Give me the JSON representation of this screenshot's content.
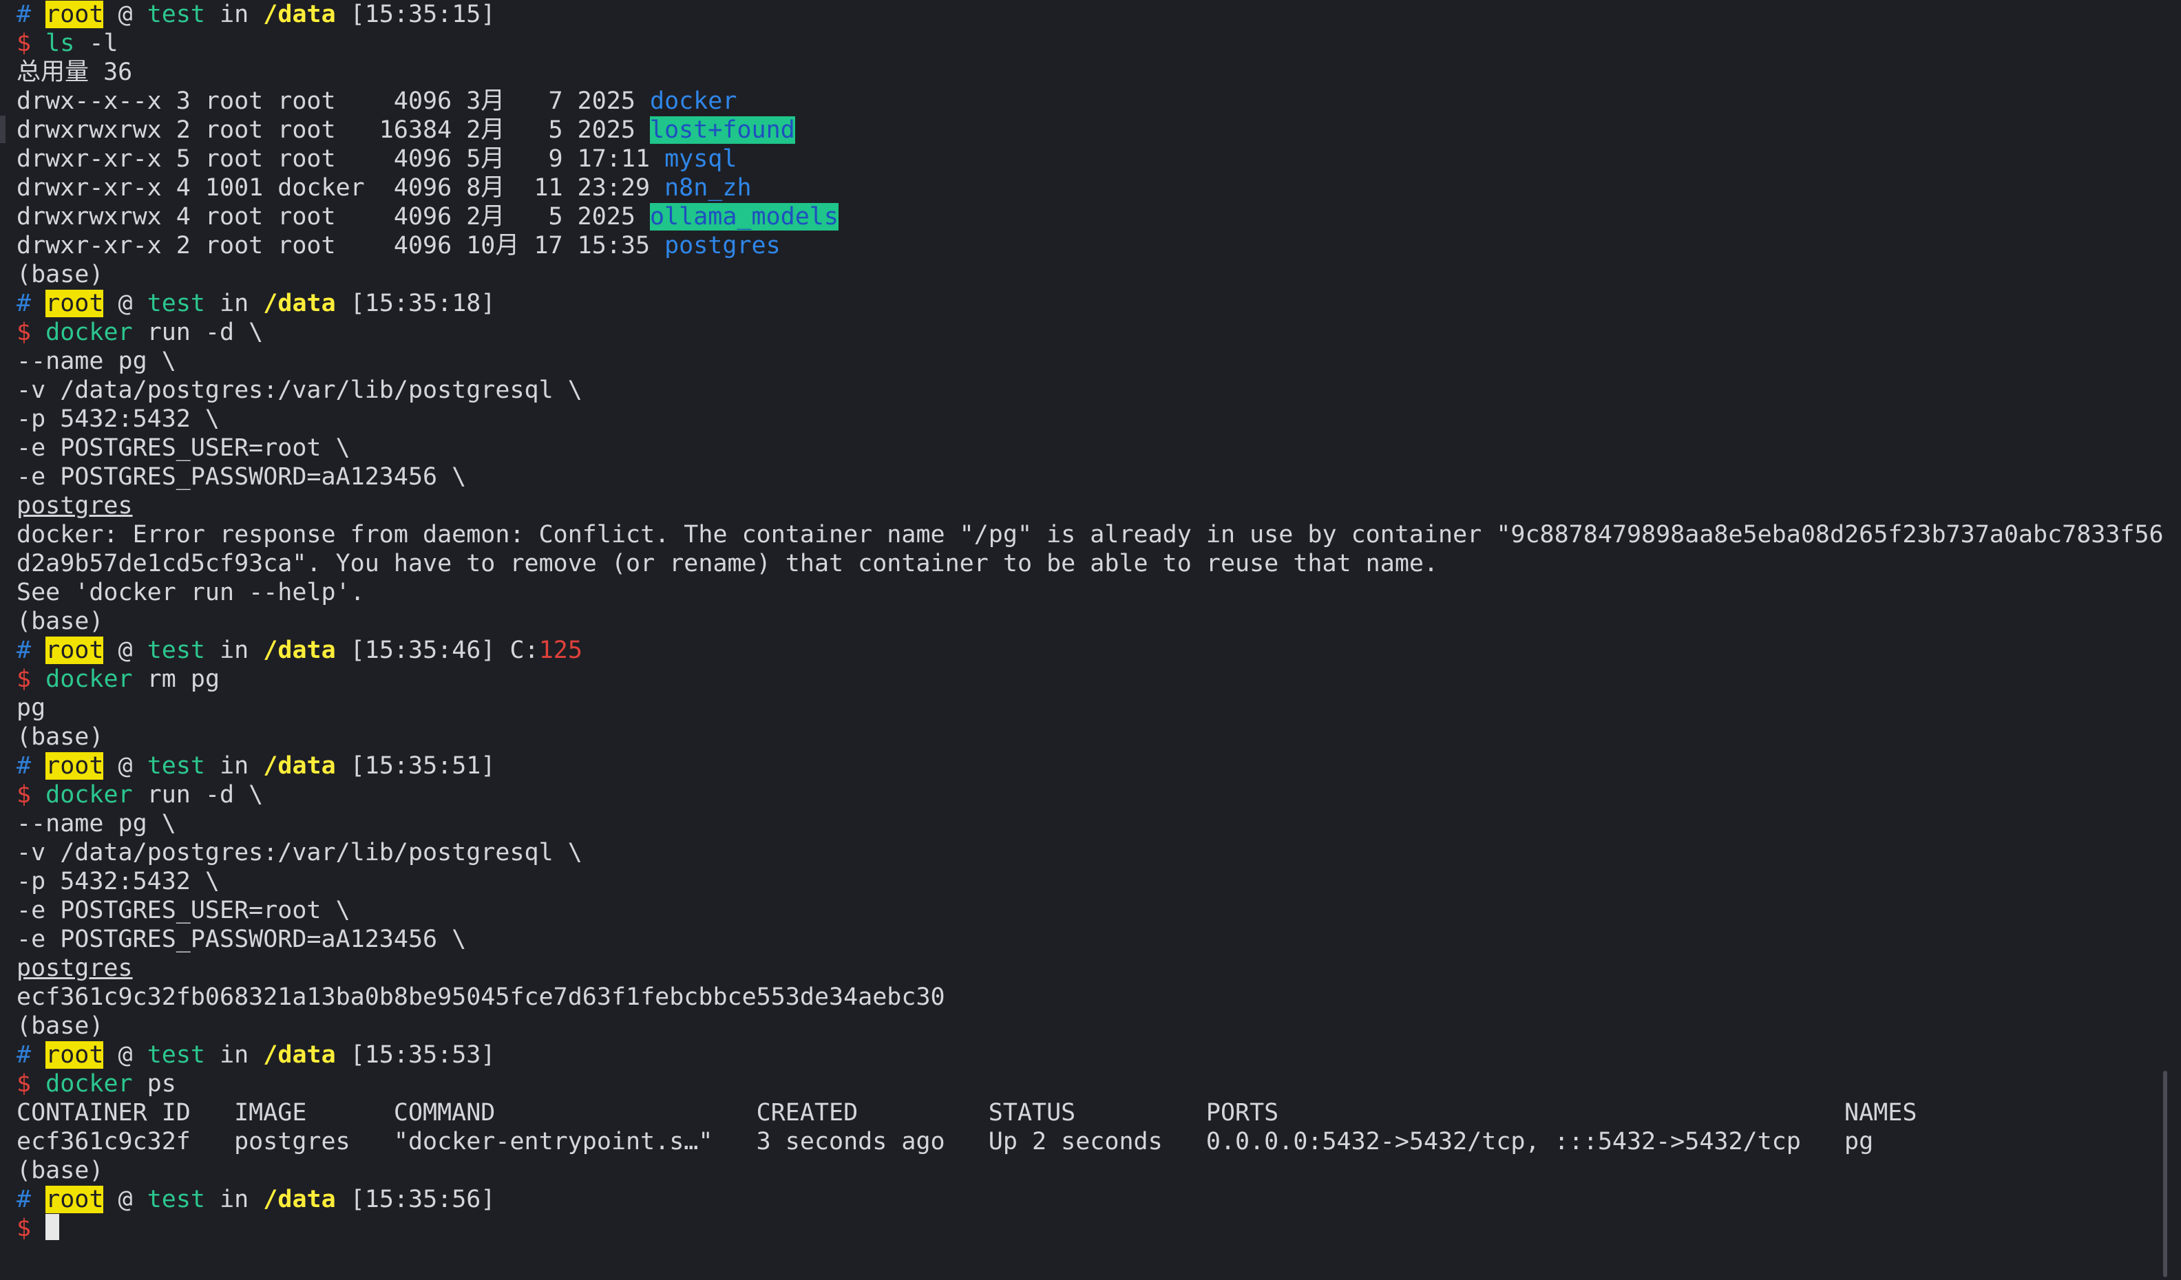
{
  "prompt": {
    "hash": "#",
    "user": "root",
    "at": "@",
    "host": "test",
    "in": "in",
    "path": "/data",
    "dollar": "$",
    "code_label": "C:"
  },
  "blocks": [
    {
      "time": "[15:35:15]",
      "cmd": "ls",
      "args": " -l",
      "output": {
        "total": "总用量 36",
        "ls_rows": [
          {
            "meta": "drwx--x--x 3 root root    4096 3月   7 2025 ",
            "name": "docker",
            "highlight": false
          },
          {
            "meta": "drwxrwxrwx 2 root root   16384 2月   5 2025 ",
            "name": "lost+found",
            "highlight": true
          },
          {
            "meta": "drwxr-xr-x 5 root root    4096 5月   9 17:11 ",
            "name": "mysql",
            "highlight": false
          },
          {
            "meta": "drwxr-xr-x 4 1001 docker  4096 8月  11 23:29 ",
            "name": "n8n_zh",
            "highlight": false
          },
          {
            "meta": "drwxrwxrwx 4 root root    4096 2月   5 2025 ",
            "name": "ollama_models",
            "highlight": true
          },
          {
            "meta": "drwxr-xr-x 2 root root    4096 10月 17 15:35 ",
            "name": "postgres",
            "highlight": false
          }
        ]
      },
      "base": "(base)"
    },
    {
      "time": "[15:35:18]",
      "cmd": "docker",
      "args": " run -d \\",
      "continuation": [
        "--name pg \\",
        "-v /data/postgres:/var/lib/postgresql \\",
        "-p 5432:5432 \\",
        "-e POSTGRES_USER=root \\",
        "-e POSTGRES_PASSWORD=aA123456 \\"
      ],
      "image": "postgres",
      "error": [
        "docker: Error response from daemon: Conflict. The container name \"/pg\" is already in use by container \"9c8878479898aa8e5eba08d265f23b737a0abc7833f56",
        "d2a9b57de1cd5cf93ca\". You have to remove (or rename) that container to be able to reuse that name.",
        "See 'docker run --help'."
      ],
      "base": "(base)"
    },
    {
      "time": "[15:35:46]",
      "exit_code": "125",
      "cmd": "docker",
      "args": " rm pg",
      "output_text": "pg",
      "base": "(base)"
    },
    {
      "time": "[15:35:51]",
      "cmd": "docker",
      "args": " run -d \\",
      "continuation": [
        "--name pg \\",
        "-v /data/postgres:/var/lib/postgresql \\",
        "-p 5432:5432 \\",
        "-e POSTGRES_USER=root \\",
        "-e POSTGRES_PASSWORD=aA123456 \\"
      ],
      "image": "postgres",
      "container_id": "ecf361c9c32fb068321a13ba0b8be95045fce7d63f1febcbbce553de34aebc30",
      "base": "(base)"
    },
    {
      "time": "[15:35:53]",
      "cmd": "docker",
      "args": " ps",
      "ps_header": "CONTAINER ID   IMAGE      COMMAND                  CREATED         STATUS         PORTS                                       NAMES",
      "ps_row": "ecf361c9c32f   postgres   \"docker-entrypoint.s…\"   3 seconds ago   Up 2 seconds   0.0.0.0:5432->5432/tcp, :::5432->5432/tcp   pg",
      "base": "(base)"
    },
    {
      "time": "[15:35:56]"
    }
  ]
}
